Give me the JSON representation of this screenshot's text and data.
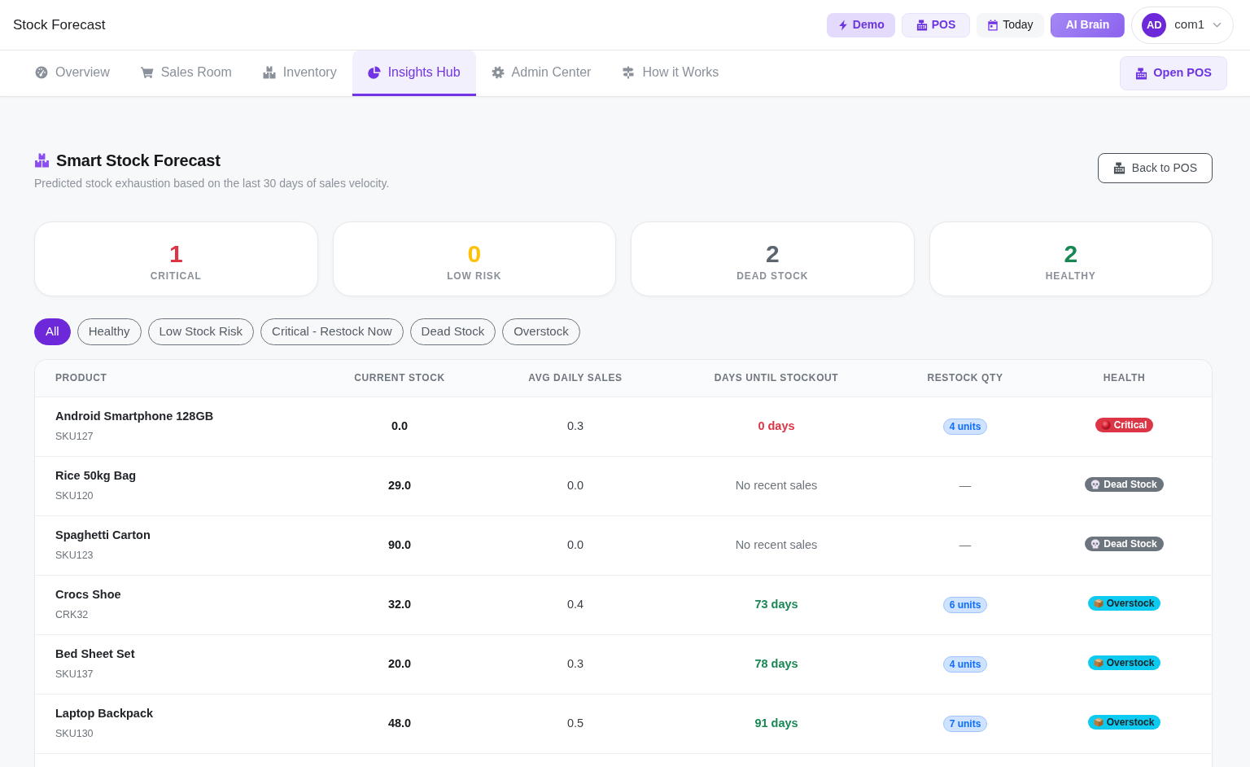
{
  "header": {
    "brand": "Stock Forecast",
    "buttons": [
      {
        "label": "Demo",
        "kind": "demo"
      },
      {
        "label": "POS",
        "kind": "pos"
      },
      {
        "label": "Today",
        "kind": "today"
      },
      {
        "label": "AI Brain",
        "kind": "ai"
      }
    ],
    "user": {
      "initials": "AD",
      "name": "com1"
    }
  },
  "nav": {
    "tabs": [
      {
        "label": "Overview",
        "selected": false
      },
      {
        "label": "Sales Room",
        "selected": false
      },
      {
        "label": "Inventory",
        "selected": false
      },
      {
        "label": "Insights Hub",
        "selected": true
      },
      {
        "label": "Admin Center",
        "selected": false
      },
      {
        "label": "How it Works",
        "selected": false
      }
    ],
    "action": "Open POS"
  },
  "page": {
    "title": "Smart Stock Forecast",
    "subtitle": "Predicted stock exhaustion based on the last 30 days of sales velocity.",
    "back_button": "Back to POS"
  },
  "stats": [
    {
      "value": "1",
      "label": "CRITICAL",
      "color": "#dc3545"
    },
    {
      "value": "0",
      "label": "LOW RISK",
      "color": "#ffc107"
    },
    {
      "value": "2",
      "label": "DEAD STOCK",
      "color": "#5b6670"
    },
    {
      "value": "2",
      "label": "HEALTHY",
      "color": "#198754"
    }
  ],
  "filters": [
    {
      "label": "All",
      "selected": true
    },
    {
      "label": "Healthy",
      "selected": false
    },
    {
      "label": "Low Stock Risk",
      "selected": false
    },
    {
      "label": "Critical - Restock Now",
      "selected": false
    },
    {
      "label": "Dead Stock",
      "selected": false
    },
    {
      "label": "Overstock",
      "selected": false
    }
  ],
  "table": {
    "columns": [
      "PRODUCT",
      "CURRENT STOCK",
      "AVG DAILY SALES",
      "DAYS UNTIL STOCKOUT",
      "RESTOCK QTY",
      "HEALTH"
    ],
    "rows": [
      {
        "product": "Android Smartphone 128GB",
        "sku": "SKU127",
        "current_stock": "0.0",
        "avg_daily_sales": "0.3",
        "days_until_stockout": "0 days",
        "restock_qty": {
          "text": "4 units",
          "kind": "pill"
        },
        "health": {
          "label": "Critical",
          "kind": "critical"
        }
      },
      {
        "product": "Rice 50kg Bag",
        "sku": "SKU120",
        "current_stock": "29.0",
        "avg_daily_sales": "0.0",
        "days_until_stockout": "No recent sales",
        "restock_qty": {
          "text": "—",
          "kind": "plain"
        },
        "health": {
          "label": "Dead Stock",
          "kind": "dead"
        }
      },
      {
        "product": "Spaghetti Carton",
        "sku": "SKU123",
        "current_stock": "90.0",
        "avg_daily_sales": "0.0",
        "days_until_stockout": "No recent sales",
        "restock_qty": {
          "text": "—",
          "kind": "plain"
        },
        "health": {
          "label": "Dead Stock",
          "kind": "dead"
        }
      },
      {
        "product": "Crocs Shoe",
        "sku": "CRK32",
        "current_stock": "32.0",
        "avg_daily_sales": "0.4",
        "days_until_stockout": "73 days",
        "restock_qty": {
          "text": "6 units",
          "kind": "pill"
        },
        "health": {
          "label": "Overstock",
          "kind": "overstock"
        }
      },
      {
        "product": "Bed Sheet Set",
        "sku": "SKU137",
        "current_stock": "20.0",
        "avg_daily_sales": "0.3",
        "days_until_stockout": "78 days",
        "restock_qty": {
          "text": "4 units",
          "kind": "pill"
        },
        "health": {
          "label": "Overstock",
          "kind": "overstock"
        }
      },
      {
        "product": "Laptop Backpack",
        "sku": "SKU130",
        "current_stock": "48.0",
        "avg_daily_sales": "0.5",
        "days_until_stockout": "91 days",
        "restock_qty": {
          "text": "7 units",
          "kind": "pill"
        },
        "health": {
          "label": "Overstock",
          "kind": "overstock"
        }
      }
    ]
  }
}
